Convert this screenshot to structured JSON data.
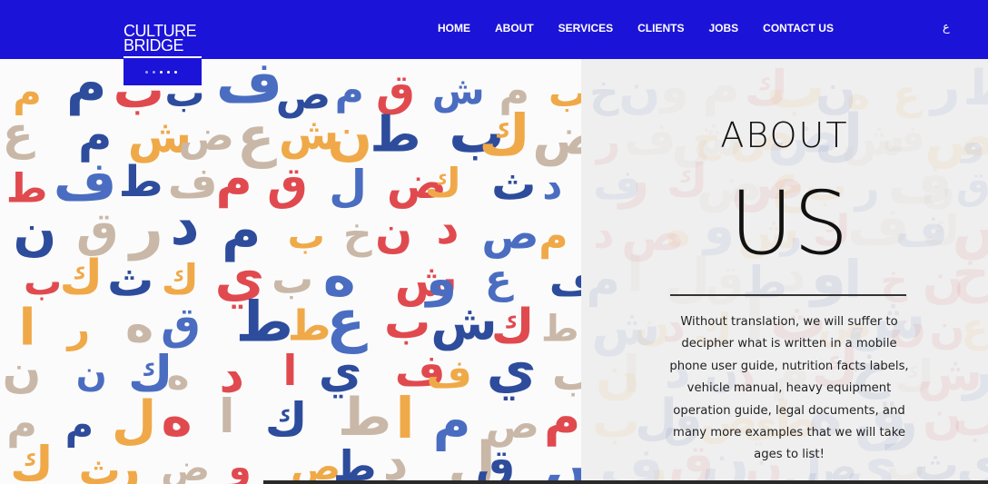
{
  "brand": {
    "line1": "CULTURE",
    "line2": "BRIDGE",
    "primary_color": "#1c13d8"
  },
  "nav": {
    "items": [
      "HOME",
      "ABOUT",
      "SERVICES",
      "CLIENTS",
      "JOBS",
      "CONTACT US"
    ],
    "language_toggle": "ع"
  },
  "slider": {
    "dot_count": 5,
    "active_dot": 2
  },
  "about": {
    "title": "ABOUT",
    "subtitle": "US",
    "body": "Without translation, we will suffer to decipher what is written in a mobile phone user guide, nutrition facts labels, vehicle manual, heavy equipment operation guide, legal documents, and many more examples that we will take ages to list!"
  },
  "pattern": {
    "glyphs": [
      "ك",
      "ط",
      "ف",
      "خ",
      "ش",
      "و",
      "ا",
      "ه",
      "م",
      "ب",
      "ي",
      "ص",
      "ع",
      "د",
      "ل",
      "ق",
      "ر",
      "ض",
      "ث",
      "ن"
    ],
    "colors": [
      "#e04a4f",
      "#f0a948",
      "#2e4c9c",
      "#c9b8a8",
      "#4a6dc1"
    ]
  }
}
